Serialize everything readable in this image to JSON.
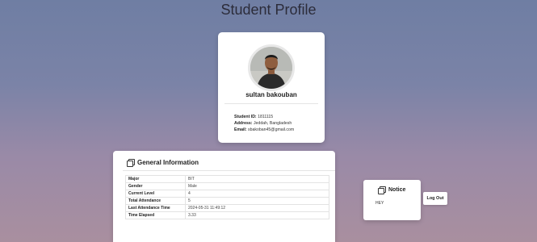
{
  "page": {
    "title": "Student Profile"
  },
  "profile": {
    "name": "sultan bakouban",
    "student_id_label": "Student ID:",
    "student_id": "1811115",
    "address_label": "Address:",
    "address": "Jeddah, Bangladesh",
    "email_label": "Email:",
    "email": "sbakoban45@gmail.com"
  },
  "general_info": {
    "title": "General Information",
    "icon": "cards-icon",
    "rows": [
      {
        "key": "Major",
        "value": "BIT"
      },
      {
        "key": "Gender",
        "value": "Male"
      },
      {
        "key": "Current Level",
        "value": "4"
      },
      {
        "key": "Total Attendance",
        "value": "5"
      },
      {
        "key": "Last Attendance Time",
        "value": "2024-05-31 11:49:12"
      },
      {
        "key": "Time Elapsed",
        "value": "3.33"
      }
    ]
  },
  "notice": {
    "title": "Notice",
    "icon": "cards-icon",
    "text": "HEY"
  },
  "actions": {
    "logout_label": "Log Out"
  }
}
